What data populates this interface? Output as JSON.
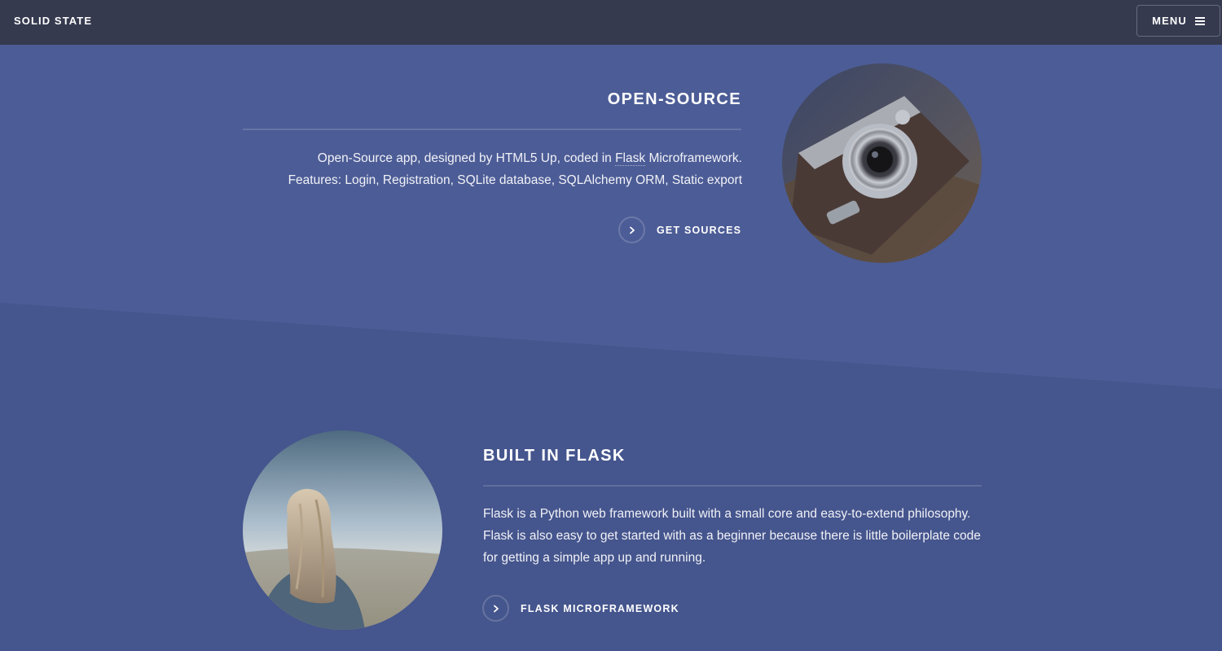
{
  "header": {
    "brand": "SOLID STATE",
    "menu_label": "MENU"
  },
  "spotlight_open_source": {
    "title": "OPEN-SOURCE",
    "line1_before_link": "Open-Source app, designed by HTML5 Up, coded in ",
    "line1_link": "Flask",
    "line1_after_link": " Microframework.",
    "line2": "Features: Login, Registration, SQLite database, SQLAlchemy ORM, Static export",
    "action_label": "GET SOURCES",
    "image_icon": "camera-photo"
  },
  "spotlight_flask": {
    "title": "BUILT IN FLASK",
    "paragraph": "Flask is a Python web framework built with a small core and easy-to-extend philosophy. Flask is also easy to get started with as a beginner because there is little boilerplate code for getting a simple app up and running.",
    "action_label": "FLASK MICROFRAMEWORK",
    "image_icon": "woman-landscape-photo"
  },
  "colors": {
    "header_bg": "#363a4f",
    "section_one_bg": "#4c5c96",
    "section_two_bg": "#45558d",
    "text": "#ffffff"
  }
}
